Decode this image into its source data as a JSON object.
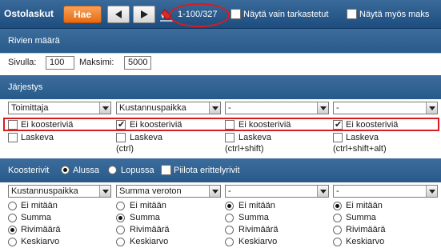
{
  "header": {
    "title": "Ostolaskut",
    "search_label": "Hae",
    "prev_label": "◀",
    "next_label": "▶",
    "range_text": "1-100/327",
    "only_checked_label": "Näytä vain tarkastetut",
    "show_also_label": "Näytä myös maks"
  },
  "rows_section": {
    "heading": "Rivien määrä",
    "page_label": "Sivulla:",
    "page_value": "100",
    "max_label": "Maksimi:",
    "max_value": "5000"
  },
  "order_section": {
    "heading": "Järjestys",
    "columns": [
      {
        "select": "Toimittaja",
        "summary_checked": false,
        "summary_label": "Ei koosteriviä",
        "desc_label": "Laskeva",
        "desc_hint": ""
      },
      {
        "select": "Kustannuspaikka",
        "summary_checked": true,
        "summary_label": "Ei koosteriviä",
        "desc_label": "Laskeva",
        "desc_hint": "(ctrl)"
      },
      {
        "select": "-",
        "summary_checked": false,
        "summary_label": "Ei koosteriviä",
        "desc_label": "Laskeva",
        "desc_hint": "(ctrl+shift)"
      },
      {
        "select": "-",
        "summary_checked": true,
        "summary_label": "Ei koosteriviä",
        "desc_label": "Laskeva",
        "desc_hint": "(ctrl+shift+alt)"
      }
    ]
  },
  "summary_section": {
    "heading": "Koosterivit",
    "start_label": "Alussa",
    "end_label": "Lopussa",
    "hide_detail_label": "Piilota erittelyrivit",
    "columns": [
      {
        "select": "Kustannuspaikka",
        "selected": "Rivimäärä"
      },
      {
        "select": "Summa veroton",
        "selected": "Summa"
      },
      {
        "select": "-",
        "selected": "Ei mitään"
      },
      {
        "select": "-",
        "selected": "Ei mitään"
      }
    ],
    "options": [
      "Ei mitään",
      "Summa",
      "Rivimäärä",
      "Keskiarvo"
    ]
  },
  "colors": {
    "header_blue": "#1d4d7e",
    "orange": "#e86a10",
    "highlight_red": "#d91c1c"
  }
}
